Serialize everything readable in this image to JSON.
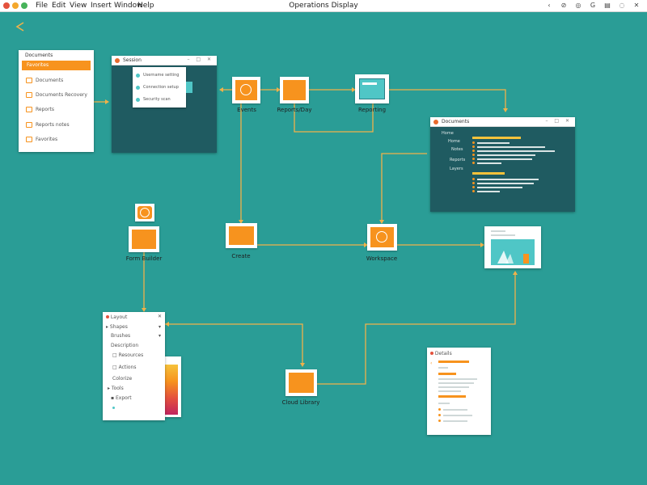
{
  "menubar": {
    "window_controls": {
      "close": "#e4513d",
      "minimize": "#f4a82d",
      "maximize": "#47b35a"
    },
    "items": [
      "File",
      "Edit",
      "View",
      "Insert",
      "Window",
      "Help"
    ],
    "app_title": "Operations Display",
    "status_icons": [
      "‹",
      "⊘",
      "◎",
      "G",
      "▤",
      "◌",
      "✕"
    ]
  },
  "colors": {
    "background": "#2a9d96",
    "accent": "#f7931e",
    "edge": "#f0b24a",
    "dark_panel": "#1f5b61"
  },
  "top_left_icon": "arrow-icon",
  "file_panel": {
    "title": "Documents",
    "selected": "Favorites",
    "items": [
      "Documents",
      "Documents Recovery",
      "Reports",
      "Reports notes",
      "Favorites"
    ]
  },
  "dialog_window": {
    "title": "Session",
    "rows": [
      "Username setting",
      "Connection setup",
      "Security scan"
    ]
  },
  "nodes": {
    "top": [
      "Events",
      "Reports/Day",
      "Reporting"
    ],
    "middle": [
      "Form Builder",
      "Create",
      "Workspace"
    ],
    "bottom": "Cloud Library"
  },
  "code_window": {
    "title": "Documents",
    "sidebar": [
      "Home",
      "Home",
      "Notes",
      "Reports",
      "Layers"
    ]
  },
  "properties_panel": {
    "title": "Layout",
    "rows": [
      "Shapes",
      "Brushes",
      "Description",
      "Resources",
      "Actions",
      "Colorize",
      "Tools",
      "Export"
    ]
  },
  "form_panel": {
    "title": "Details"
  }
}
